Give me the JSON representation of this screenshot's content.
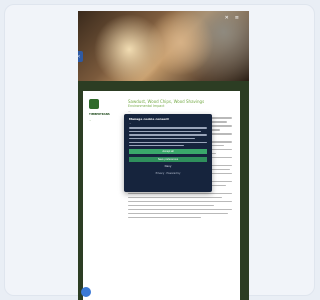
{
  "page": {
    "hero_icons": [
      "✕",
      "≡"
    ],
    "side_tab": "‹"
  },
  "logo": {
    "name": "TIMBERTRANS",
    "tagline": "..."
  },
  "article": {
    "title": "Sawdust, Wood Chips, Wood Shavings",
    "subtitle": "Environmental Impact",
    "lead": "..."
  },
  "consent": {
    "title": "Manage cookie consent",
    "text": "...",
    "accept_label": "Accept all",
    "save_label": "Save preferences",
    "deny_label": "Deny",
    "privacy_link": "Privacy",
    "powered_by": "Powered by"
  }
}
